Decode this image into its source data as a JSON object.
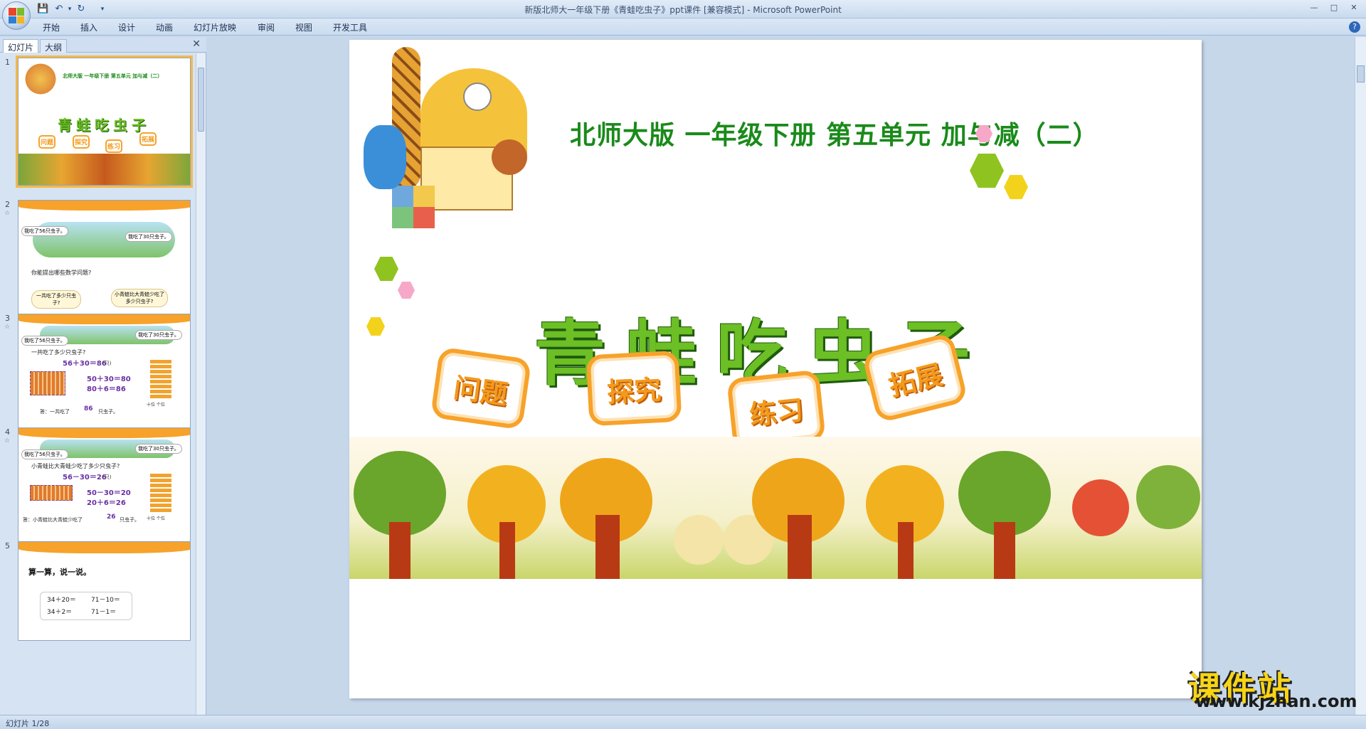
{
  "window": {
    "title": "新版北师大一年级下册《青蛙吃虫子》ppt课件 [兼容模式] - Microsoft PowerPoint"
  },
  "ribbon": {
    "tabs": [
      "开始",
      "插入",
      "设计",
      "动画",
      "幻灯片放映",
      "审阅",
      "视图",
      "开发工具"
    ]
  },
  "panel": {
    "tabs": [
      "幻灯片",
      "大纲"
    ],
    "slides": [
      {
        "number": "1",
        "title": "青蛙吃虫子",
        "subtitle": "北师大版 一年级下册 第五单元 加与减（二）",
        "buttons": [
          "问题",
          "探究",
          "练习",
          "拓展"
        ]
      },
      {
        "number": "2",
        "bubble_left": "我吃了56只虫子。",
        "bubble_right": "我吃了30只虫子。",
        "question": "你能提出哪些数学问题?",
        "cloud_left": "一共吃了多少只虫子?",
        "cloud_right": "小青蛙比大青蛙少吃了多少只虫子?"
      },
      {
        "number": "3",
        "bubble_left": "我吃了56只虫子。",
        "bubble_right": "我吃了30只虫子。",
        "question": "一共吃了多少只虫子?",
        "equation": "56＋30＝86",
        "unit": "(只)",
        "line1": "50＋30＝80",
        "line2": "80＋6＝86",
        "answer": "答：一共吃了",
        "answer_value": "86",
        "answer_tail": "只虫子。",
        "abacus_label": "十位 个位"
      },
      {
        "number": "4",
        "bubble_left": "我吃了56只虫子。",
        "bubble_right": "我吃了30只虫子。",
        "question": "小青蛙比大青蛙少吃了多少只虫子?",
        "equation": "56－30＝26",
        "unit": "(只)",
        "line1": "50－30＝20",
        "line2": "20＋6＝26",
        "answer": "答：小青蛙比大青蛙少吃了",
        "answer_value": "26",
        "answer_tail": "只虫子。",
        "abacus_label": "十位 个位"
      },
      {
        "number": "5",
        "heading": "算一算，说一说。",
        "calc": [
          "34＋20＝",
          "71－10＝",
          "34＋2＝",
          "71－1＝"
        ]
      }
    ]
  },
  "slide": {
    "subtitle": "北师大版  一年级下册  第五单元  加与减（二）",
    "title": "青蛙吃虫子",
    "buttons": [
      "问题",
      "探究",
      "练习",
      "拓展"
    ]
  },
  "watermark": {
    "cn": "课件站",
    "url": "www.kjzhan.com"
  },
  "status": {
    "slide_info": "幻灯片 1/28"
  },
  "colors": {
    "title_green": "#6cbf24",
    "subtitle_green": "#1a8a1a",
    "button_orange": "#f7a22a",
    "hex_green": "#8fc31f",
    "hex_yellow": "#f3d21c",
    "hex_pink": "#f7a8c8"
  }
}
